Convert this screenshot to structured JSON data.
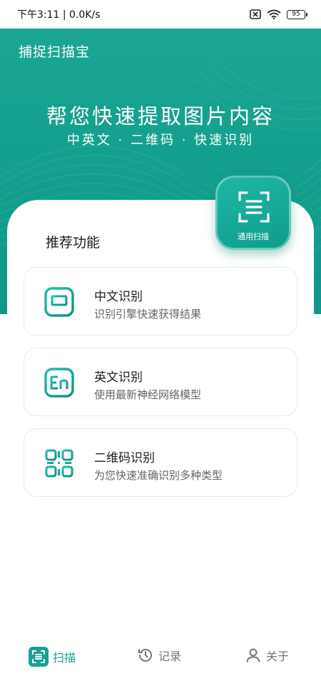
{
  "status_bar": {
    "time_speed": "下午3:11 | 0.0K/s",
    "battery": "95"
  },
  "header": {
    "app_title": "捕捉扫描宝",
    "headline": "帮您快速提取图片内容",
    "subline": "中英文 · 二维码 · 快速识别"
  },
  "scan_button": {
    "label": "通用扫描"
  },
  "section": {
    "title": "推荐功能"
  },
  "features": [
    {
      "title": "中文识别",
      "subtitle": "识别引擎快速获得结果",
      "icon": "chinese-char-icon"
    },
    {
      "title": "英文识别",
      "subtitle": "使用最新神经网络模型",
      "icon": "english-en-icon"
    },
    {
      "title": "二维码识别",
      "subtitle": "为您快速准确识别多种类型",
      "icon": "qr-code-icon"
    }
  ],
  "tabbar": {
    "items": [
      {
        "label": "扫描",
        "icon": "scan-icon",
        "active": true
      },
      {
        "label": "记录",
        "icon": "history-icon",
        "active": false
      },
      {
        "label": "关于",
        "icon": "user-icon",
        "active": false
      }
    ]
  },
  "colors": {
    "accent": "#17a392",
    "hero_bg": "#14a08e"
  }
}
